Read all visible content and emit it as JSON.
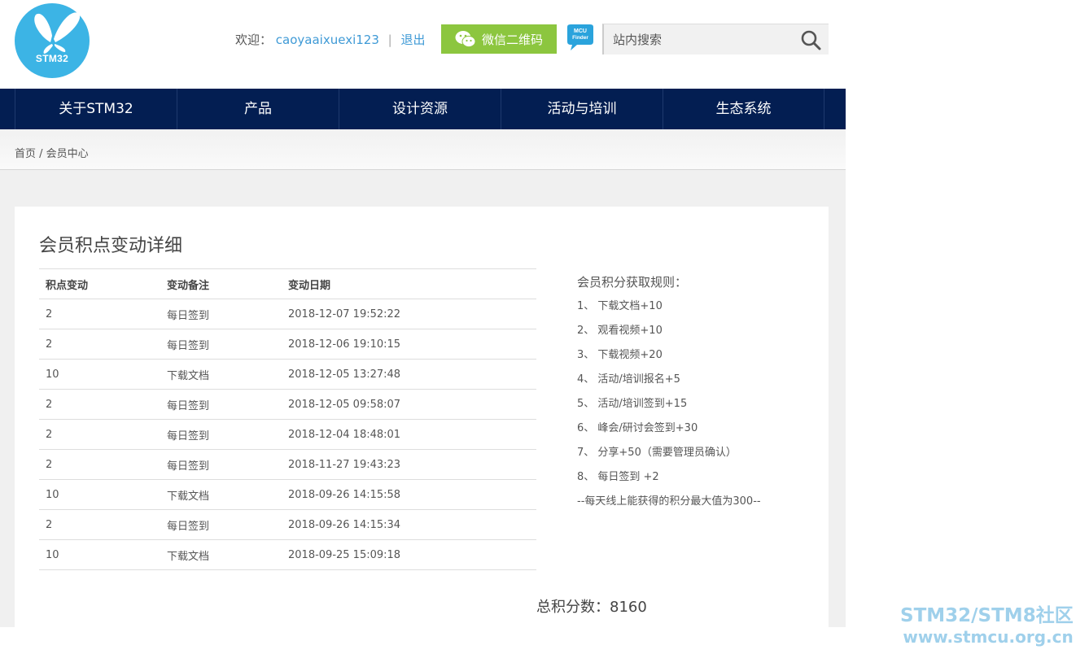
{
  "header": {
    "logo_text": "STM32",
    "welcome_label": "欢迎：",
    "username": "caoyaaixuexi123",
    "logout": "退出",
    "wechat_button": "微信二维码",
    "mcu_finder_lines": [
      "MCU",
      "Finder"
    ],
    "search_placeholder": "站内搜索"
  },
  "nav": {
    "items": [
      "关于STM32",
      "产品",
      "设计资源",
      "活动与培训",
      "生态系统"
    ]
  },
  "breadcrumb": {
    "home": "首页",
    "separator": " / ",
    "current": "会员中心"
  },
  "main": {
    "title": "会员积点变动详细",
    "table": {
      "headers": [
        "积点变动",
        "变动备注",
        "变动日期"
      ],
      "rows": [
        [
          "2",
          "每日签到",
          "2018-12-07 19:52:22"
        ],
        [
          "2",
          "每日签到",
          "2018-12-06 19:10:15"
        ],
        [
          "10",
          "下载文档",
          "2018-12-05 13:27:48"
        ],
        [
          "2",
          "每日签到",
          "2018-12-05 09:58:07"
        ],
        [
          "2",
          "每日签到",
          "2018-12-04 18:48:01"
        ],
        [
          "2",
          "每日签到",
          "2018-11-27 19:43:23"
        ],
        [
          "10",
          "下载文档",
          "2018-09-26 14:15:58"
        ],
        [
          "2",
          "每日签到",
          "2018-09-26 14:15:34"
        ],
        [
          "10",
          "下载文档",
          "2018-09-25 15:09:18"
        ]
      ]
    },
    "rules": {
      "title": "会员积分获取规则：",
      "items": [
        "1、 下载文档+10",
        "2、 观看视频+10",
        "3、 下载视频+20",
        "4、 活动/培训报名+5",
        "5、 活动/培训签到+15",
        "6、 峰会/研讨会签到+30",
        "7、 分享+50（需要管理员确认）",
        "8、 每日签到 +2"
      ],
      "note": "--每天线上能获得的积分最大值为300--"
    },
    "total": "总积分数：8160"
  },
  "watermark": {
    "line1": "STM32/STM8社区",
    "line2": "www.stmcu.org.cn"
  },
  "colors": {
    "nav_bg": "#031e52",
    "logo_blue": "#3cb4e5",
    "wechat_green": "#8cc63f",
    "link_blue": "#3f9ad6"
  }
}
